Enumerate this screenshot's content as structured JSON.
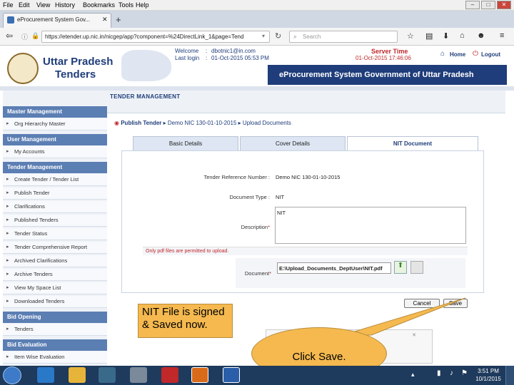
{
  "menu": [
    "File",
    "Edit",
    "View",
    "History",
    "Bookmarks",
    "Tools",
    "Help"
  ],
  "browser": {
    "tab_title": "eProcurement System Gov...",
    "url": "https://etender.up.nic.in/nicgep/app?component=%24DirectLink_1&page=Tend",
    "search_placeholder": "Search"
  },
  "site": {
    "brand_line1": "Uttar Pradesh",
    "brand_line2": "Tenders",
    "welcome_label": "Welcome",
    "welcome_value": "dbotnic1@in.com",
    "lastlogin_label": "Last login",
    "lastlogin_value": "01-Oct-2015 05:53 PM",
    "server_time_label": "Server Time",
    "server_time_value": "01-Oct-2015 17:46:06",
    "home": "Home",
    "logout": "Logout",
    "system_title": "eProcurement System Government of Uttar Pradesh"
  },
  "sidebar": {
    "sections": [
      {
        "title": "Master Management",
        "items": [
          "Org Hierarchy Master"
        ]
      },
      {
        "title": "User Management",
        "items": [
          "My Accounts"
        ]
      },
      {
        "title": "Tender Management",
        "items": [
          "Create Tender / Tender List",
          "Publish Tender",
          "Clarifications",
          "Published Tenders",
          "Tender Status",
          "Tender Comprehensive Report",
          "Archived Clarifications",
          "Archive Tenders",
          "View My Space List",
          "Downloaded Tenders"
        ]
      },
      {
        "title": "Bid Opening",
        "items": [
          "Tenders"
        ]
      },
      {
        "title": "Bid Evaluation",
        "items": [
          "Item Wise Evaluation"
        ]
      }
    ]
  },
  "main": {
    "section_title": "TENDER MANAGEMENT",
    "breadcrumb": [
      "Publish Tender",
      "Demo NIC 130-01-10-2015",
      "Upload Documents"
    ],
    "tabs": [
      "Basic Details",
      "Cover Details",
      "NIT Document"
    ],
    "form": {
      "ref_label": "Tender Reference Number :",
      "ref_value": "Demo NIC 130-01-10-2015",
      "doctype_label": "Document Type :",
      "doctype_value": "NIT",
      "desc_label": "Description",
      "desc_value": "NIT",
      "warning": "Only pdf files are permitted to upload.",
      "doc_label": "Document",
      "doc_value": "E:\\Upload_Documents_DeptUser\\NIT.pdf"
    },
    "cancel": "Cancel",
    "save": "Save"
  },
  "callouts": {
    "note": "NIT File is signed & Saved now.",
    "action": "Click Save."
  },
  "taskbar": {
    "time": "3:51 PM",
    "date": "10/1/2015"
  }
}
